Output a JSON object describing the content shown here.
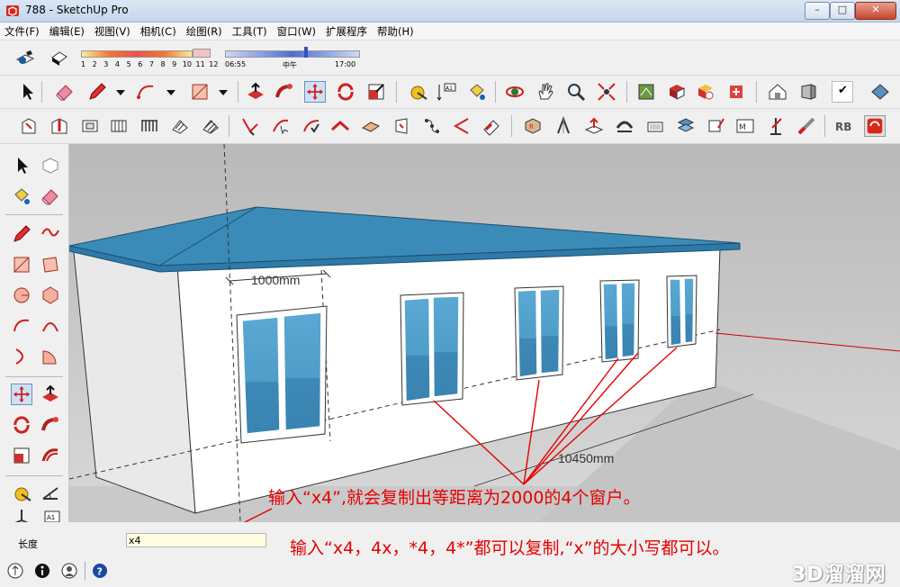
{
  "window": {
    "title": "788 - SketchUp Pro"
  },
  "menu": [
    "文件(F)",
    "编辑(E)",
    "视图(V)",
    "相机(C)",
    "绘图(R)",
    "工具(T)",
    "窗口(W)",
    "扩展程序",
    "帮助(H)"
  ],
  "shadows": {
    "months": [
      "1",
      "2",
      "3",
      "4",
      "5",
      "6",
      "7",
      "8",
      "9",
      "10",
      "11",
      "12"
    ],
    "time_start": "06:55",
    "time_mid": "中午",
    "time_end": "17:00"
  },
  "viewport": {
    "dim_window": "1000mm",
    "dim_wall": "10450mm",
    "annotation_1": "输入“x4”,就会复制出等距离为2000的4个窗户。",
    "annotation_2": "输入“x4，4x，*4，4*”都可以复制,“x”的大小写都可以。"
  },
  "vcb": {
    "label": "长度",
    "value": "x4"
  },
  "watermark": "3D溜溜网",
  "colors": {
    "roof": "#3b8bb8",
    "glass": "#4f9ec9",
    "annotation": "#e60000",
    "axis_red": "#cc0000"
  }
}
